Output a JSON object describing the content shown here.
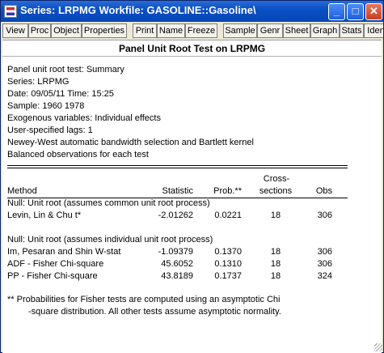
{
  "window": {
    "title": "Series: LRPMG   Workfile: GASOLINE::Gasoline\\",
    "controls": {
      "minimize": "_",
      "maximize": "□",
      "close": "✕"
    }
  },
  "toolbar": {
    "buttons": [
      "View",
      "Proc",
      "Object",
      "Properties",
      "Print",
      "Name",
      "Freeze",
      "Sample",
      "Genr",
      "Sheet",
      "Graph",
      "Stats",
      "Iden"
    ]
  },
  "output": {
    "heading": "Panel Unit Root Test on LRPMG",
    "header_lines": [
      "Panel unit root test: Summary",
      "Series:  LRPMG",
      "Date: 09/05/11   Time: 15:25",
      "Sample: 1960 1978",
      "Exogenous variables: Individual effects",
      "User-specified lags: 1",
      "Newey-West automatic bandwidth selection and Bartlett kernel",
      "Balanced observations for each test"
    ],
    "columns": {
      "method": "Method",
      "statistic": "Statistic",
      "prob": "Prob.**",
      "cross_top": "Cross-",
      "cross_bottom": "sections",
      "obs": "Obs"
    },
    "groups": [
      {
        "label": "Null: Unit root (assumes common unit root process)",
        "rows": [
          {
            "method": "Levin, Lin & Chu t*",
            "statistic": "-2.01262",
            "prob": "0.0221",
            "cross": "18",
            "obs": "306"
          }
        ]
      },
      {
        "label": "Null: Unit root (assumes individual unit root process)",
        "rows": [
          {
            "method": "Im, Pesaran and Shin W-stat",
            "statistic": "-1.09379",
            "prob": "0.1370",
            "cross": "18",
            "obs": "306"
          },
          {
            "method": "ADF - Fisher Chi-square",
            "statistic": "45.6052",
            "prob": "0.1310",
            "cross": "18",
            "obs": "306"
          },
          {
            "method": "PP - Fisher Chi-square",
            "statistic": "43.8189",
            "prob": "0.1737",
            "cross": "18",
            "obs": "324"
          }
        ]
      }
    ],
    "footnote_1": "** Probabilities for Fisher tests are computed using an asymptotic Chi",
    "footnote_2": "-square distribution. All other tests assume asymptotic normality."
  }
}
